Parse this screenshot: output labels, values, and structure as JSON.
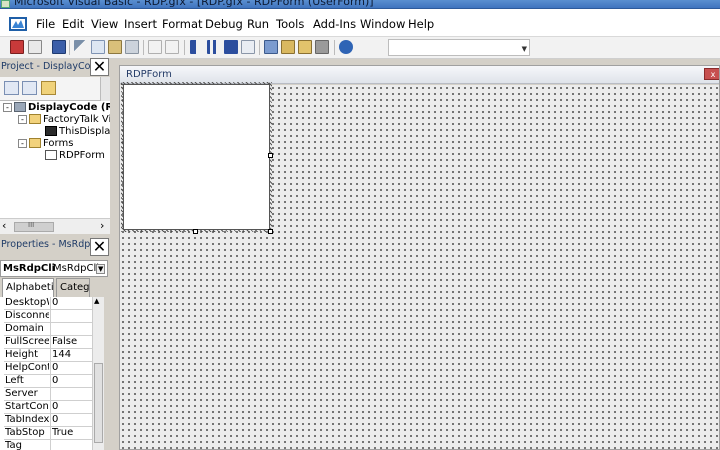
{
  "window": {
    "title": "Microsoft Visual Basic - RDP.gfx - [RDP.gfx - RDPForm (UserForm)]"
  },
  "menu": [
    "File",
    "Edit",
    "View",
    "Insert",
    "Format",
    "Debug",
    "Run",
    "Tools",
    "Add-Ins",
    "Window",
    "Help"
  ],
  "toolbar": {
    "icons": [
      "view-host-icon",
      "insert-icon",
      "save-icon",
      "cut-icon",
      "copy-icon",
      "paste-icon",
      "find-icon",
      "undo-icon",
      "redo-icon",
      "run-icon",
      "break-icon",
      "reset-icon",
      "design-mode-icon",
      "project-explorer-icon",
      "properties-icon",
      "object-browser-icon",
      "toolbox-icon",
      "help-icon"
    ],
    "combo_value": ""
  },
  "project": {
    "title": "Project - DisplayCode",
    "tree": [
      {
        "label": "DisplayCode (RDP.gfx)",
        "expander": "-"
      },
      {
        "label": "FactoryTalk View",
        "expander": "-"
      },
      {
        "label": "ThisDisplay",
        "expander": ""
      },
      {
        "label": "Forms",
        "expander": "-"
      },
      {
        "label": "RDPForm",
        "expander": ""
      }
    ],
    "scroll_left": "‹",
    "scroll_thumb": "III",
    "scroll_right": "›"
  },
  "properties": {
    "title": "Properties - MsRdpClient",
    "object_name": "MsRdpCli",
    "object_type": "MsRdpClie",
    "tabs": [
      "Alphabetic",
      "Categ"
    ],
    "rows": [
      {
        "name": "DesktopW",
        "value": "0"
      },
      {
        "name": "Disconnect",
        "value": ""
      },
      {
        "name": "Domain",
        "value": ""
      },
      {
        "name": "FullScreen",
        "value": "False"
      },
      {
        "name": "Height",
        "value": "144"
      },
      {
        "name": "HelpConte",
        "value": "0"
      },
      {
        "name": "Left",
        "value": "0"
      },
      {
        "name": "Server",
        "value": ""
      },
      {
        "name": "StartConn",
        "value": "0"
      },
      {
        "name": "TabIndex",
        "value": "0"
      },
      {
        "name": "TabStop",
        "value": "True"
      },
      {
        "name": "Tag",
        "value": ""
      }
    ]
  },
  "form_window": {
    "title": "RDPForm",
    "close_label": "x"
  },
  "close_glyph": "✕",
  "colors": {
    "titlebar": "#3f74bf",
    "form_close": "#c75050",
    "accent": "#1f3b67"
  }
}
